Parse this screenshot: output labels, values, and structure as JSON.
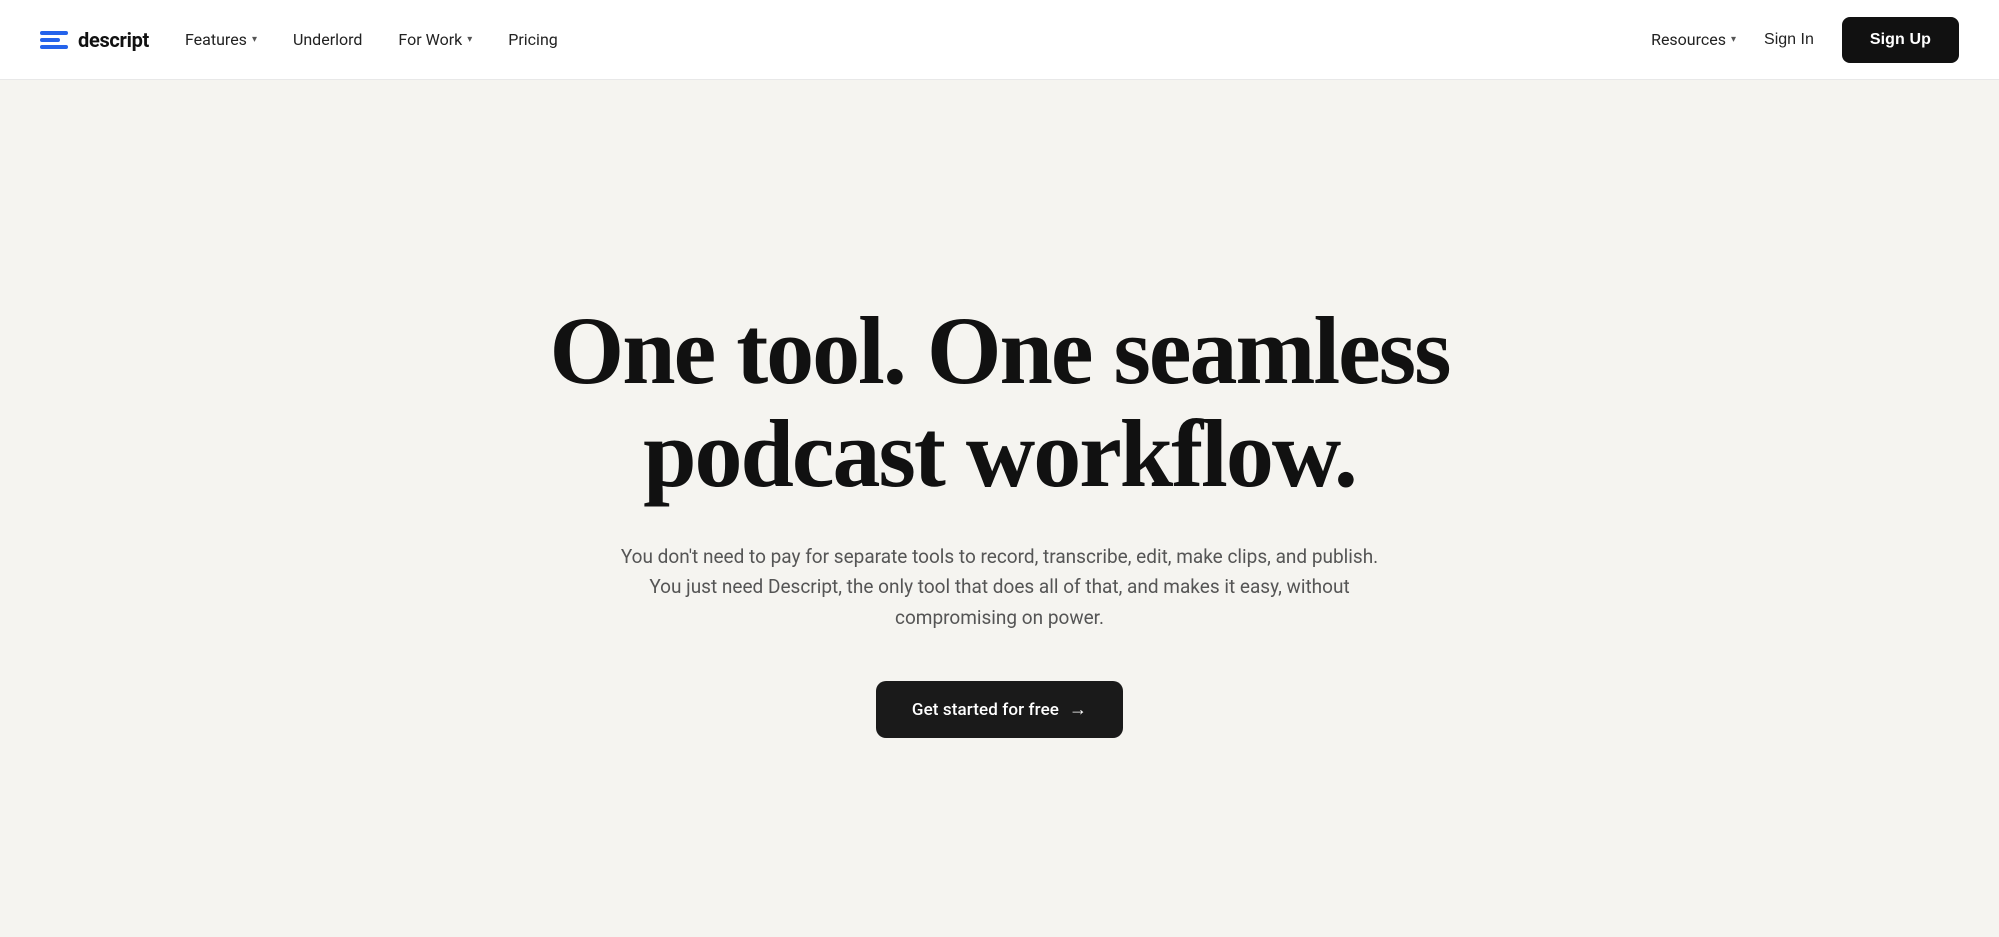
{
  "nav": {
    "logo_text": "descript",
    "links": [
      {
        "id": "features",
        "label": "Features",
        "has_dropdown": true
      },
      {
        "id": "underlord",
        "label": "Underlord",
        "has_dropdown": false
      },
      {
        "id": "for-work",
        "label": "For Work",
        "has_dropdown": true
      },
      {
        "id": "pricing",
        "label": "Pricing",
        "has_dropdown": false
      }
    ],
    "right_links": [
      {
        "id": "resources",
        "label": "Resources",
        "has_dropdown": true
      }
    ],
    "sign_in_label": "Sign In",
    "sign_up_label": "Sign Up"
  },
  "hero": {
    "headline": "One tool. One seamless podcast workflow.",
    "subtext": "You don't need to pay for separate tools to record, transcribe, edit, make clips, and publish. You just need Descript, the only tool that does all of that, and makes it easy, without compromising on power.",
    "cta_label": "Get started for free",
    "cta_arrow": "→"
  }
}
